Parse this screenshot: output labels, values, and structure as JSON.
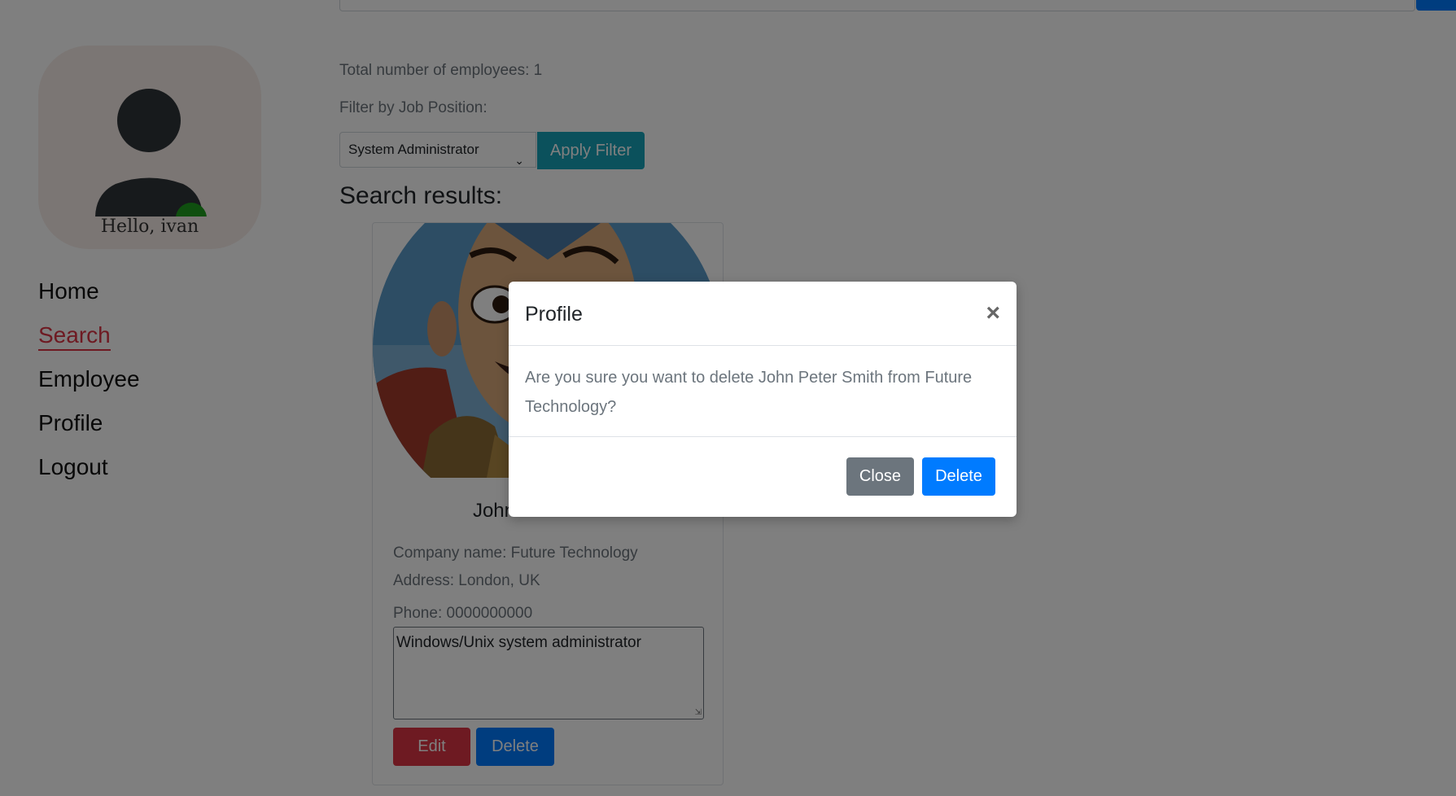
{
  "sidebar": {
    "greeting": "Hello, ivan",
    "nav": [
      {
        "label": "Home"
      },
      {
        "label": "Search",
        "active": true
      },
      {
        "label": "Employee"
      },
      {
        "label": "Profile"
      },
      {
        "label": "Logout"
      }
    ]
  },
  "main": {
    "total_employees": "Total number of employees: 1",
    "filter_label": "Filter by Job Position:",
    "filter_selected": "System Administrator",
    "apply_label": "Apply Filter",
    "results_title": "Search results:"
  },
  "card": {
    "name": "John Peter Smith",
    "company": "Company name: Future Technology",
    "address": "Address: London, UK",
    "phone": "Phone: 0000000000",
    "description": "Windows/Unix system administrator",
    "edit_label": "Edit",
    "delete_label": "Delete"
  },
  "modal": {
    "title": "Profile",
    "close_symbol": "×",
    "message": "Are you sure you want to delete John Peter Smith from Future Technology?",
    "close_label": "Close",
    "delete_label": "Delete"
  },
  "colors": {
    "danger": "#dc3545",
    "primary": "#007bff",
    "info": "#17a2b8",
    "secondary": "#6c757d",
    "online": "#1e9e1e"
  }
}
